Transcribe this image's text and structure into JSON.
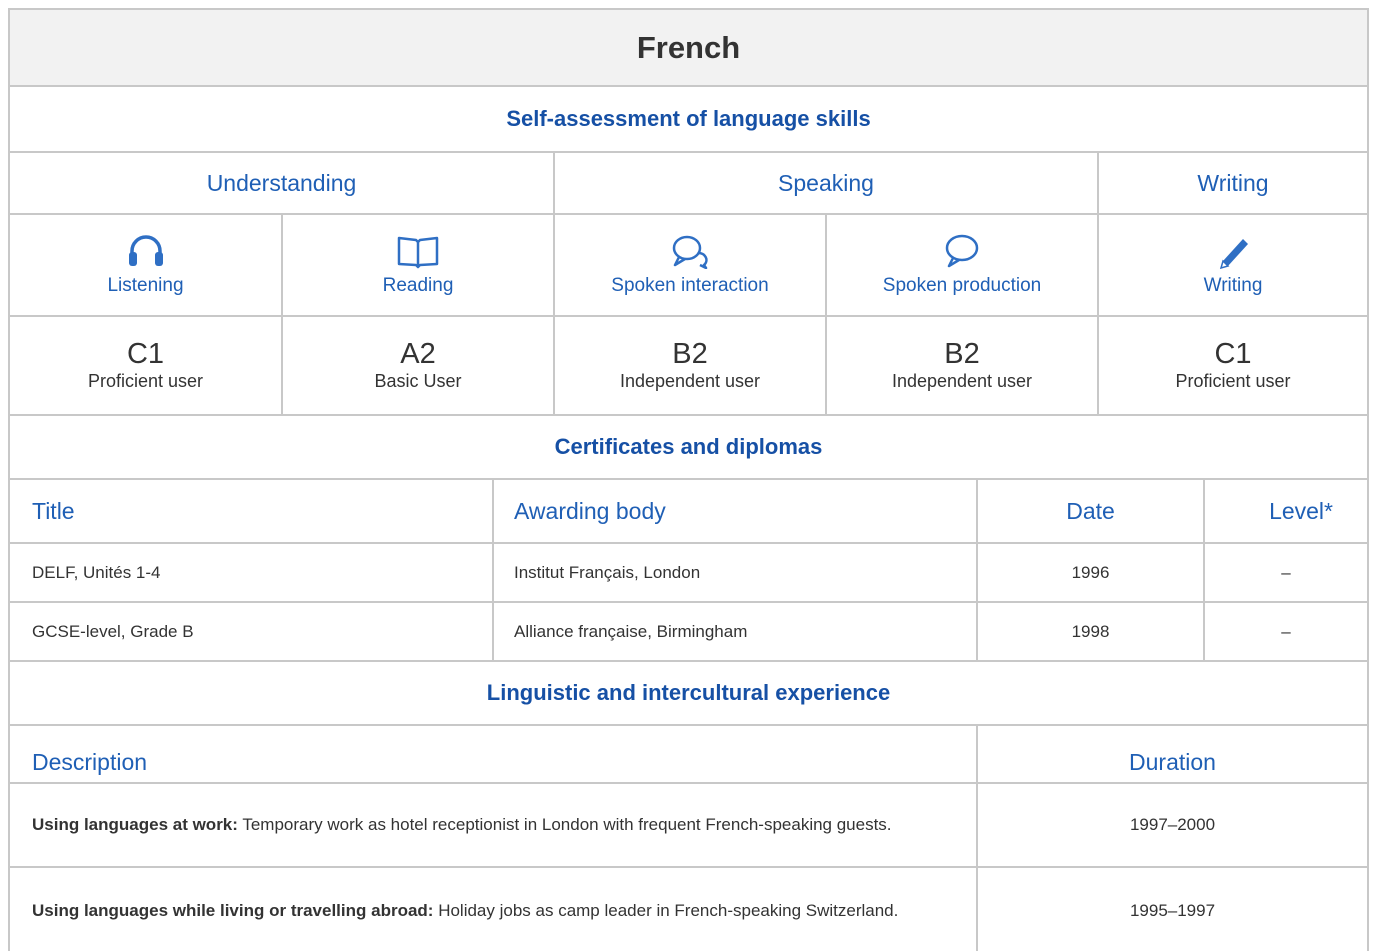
{
  "language": "French",
  "self_assessment": {
    "heading": "Self-assessment of language skills",
    "categories": [
      "Understanding",
      "Speaking",
      "Writing"
    ],
    "skills": [
      {
        "label": "Listening",
        "icon": "headphones-icon",
        "level": "C1",
        "level_desc": "Proficient user"
      },
      {
        "label": "Reading",
        "icon": "book-icon",
        "level": "A2",
        "level_desc": "Basic User"
      },
      {
        "label": "Spoken interaction",
        "icon": "chat-bubbles-icon",
        "level": "B2",
        "level_desc": "Independent user"
      },
      {
        "label": "Spoken production",
        "icon": "speech-bubble-icon",
        "level": "B2",
        "level_desc": "Independent user"
      },
      {
        "label": "Writing",
        "icon": "pencil-icon",
        "level": "C1",
        "level_desc": "Proficient user"
      }
    ]
  },
  "certificates": {
    "heading": "Certificates and diplomas",
    "columns": [
      "Title",
      "Awarding body",
      "Date",
      "Level*"
    ],
    "rows": [
      {
        "title": "DELF, Unités 1-4",
        "body": "Institut Français, London",
        "date": "1996",
        "level": "–"
      },
      {
        "title": "GCSE-level, Grade B",
        "body": "Alliance française, Birmingham",
        "date": "1998",
        "level": "–"
      }
    ]
  },
  "experience": {
    "heading": "Linguistic and intercultural experience",
    "columns": [
      "Description",
      "Duration"
    ],
    "rows": [
      {
        "label": "Using languages at work:",
        "text": " Temporary work as hotel receptionist in London with frequent French-speaking guests.",
        "duration": "1997–2000"
      },
      {
        "label": "Using languages while living or travelling abroad:",
        "text": " Holiday jobs as camp leader in French-speaking Switzerland.",
        "duration": "1995–1997"
      }
    ]
  },
  "colors": {
    "accent": "#1f5fb5",
    "heading": "#1650a5",
    "border": "#c8c8c8",
    "title_bg": "#f2f2f2"
  }
}
